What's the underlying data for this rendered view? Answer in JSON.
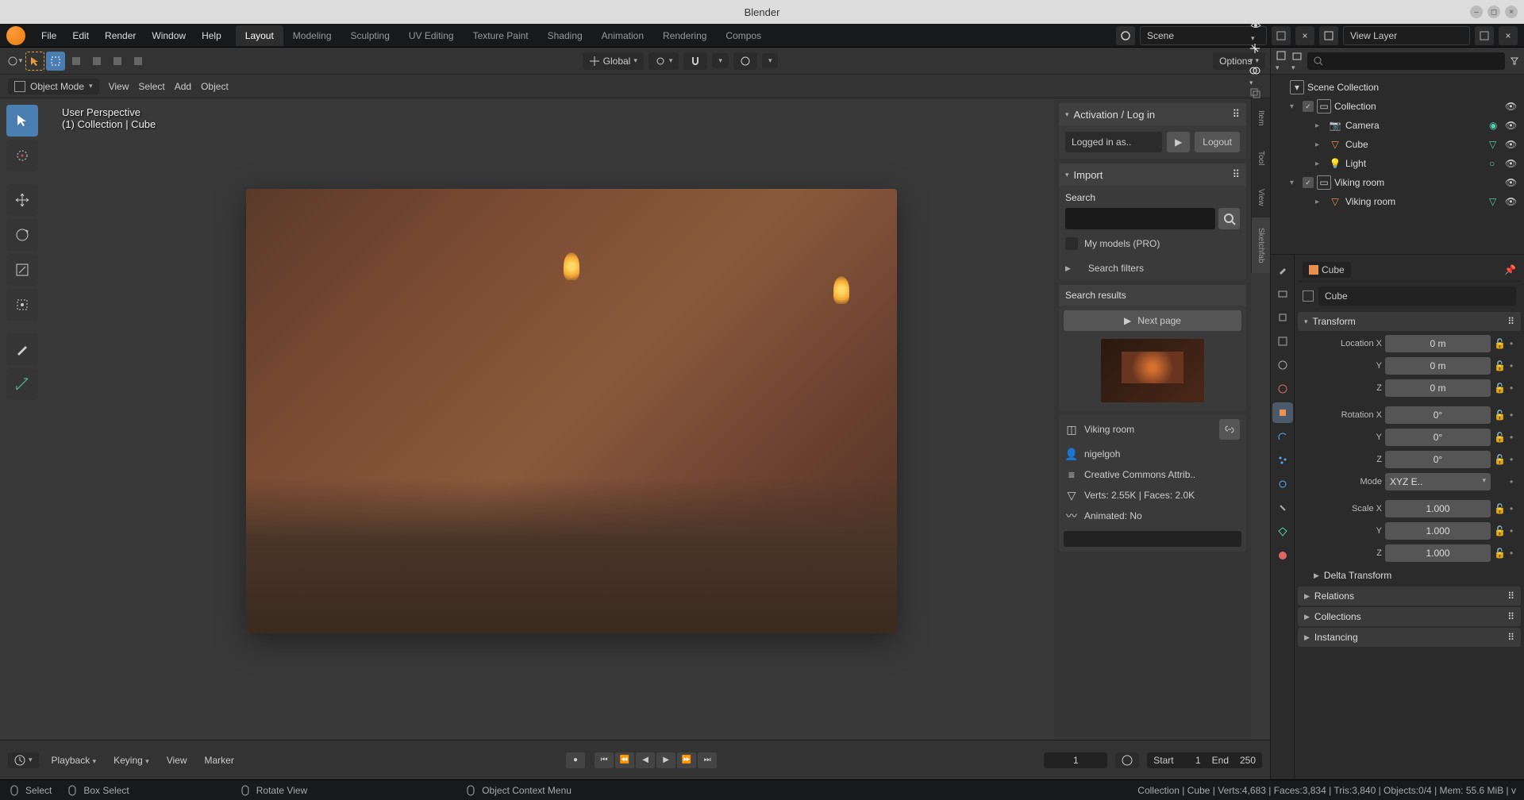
{
  "titlebar": {
    "title": "Blender"
  },
  "menubar": {
    "menus": [
      "File",
      "Edit",
      "Render",
      "Window",
      "Help"
    ],
    "tabs": [
      "Layout",
      "Modeling",
      "Sculpting",
      "UV Editing",
      "Texture Paint",
      "Shading",
      "Animation",
      "Rendering",
      "Compos"
    ],
    "active_tab": 0,
    "scene_label": "Scene",
    "layer_label": "View Layer"
  },
  "vp_header": {
    "orientation": "Global",
    "options": "Options"
  },
  "vp_subheader": {
    "mode": "Object Mode",
    "menus": [
      "View",
      "Select",
      "Add",
      "Object"
    ]
  },
  "overlay": {
    "line1": "User Perspective",
    "line2": "(1) Collection | Cube"
  },
  "side_tabs": [
    "Item",
    "Tool",
    "View",
    "Sketchfab"
  ],
  "sketchfab": {
    "activation_title": "Activation / Log in",
    "logged_in": "Logged in as..",
    "logout": "Logout",
    "import_title": "Import",
    "search_label": "Search",
    "my_models": "My models (PRO)",
    "filters": "Search filters",
    "results_title": "Search results",
    "next_page": "Next page",
    "model_name": "Viking room",
    "author": "nigelgoh",
    "license": "Creative Commons Attrib..",
    "stats": "Verts: 2.55K  |  Faces: 2.0K",
    "animated": "Animated: No"
  },
  "outliner": {
    "root": "Scene Collection",
    "items": [
      {
        "label": "Collection",
        "type": "collection"
      },
      {
        "label": "Camera",
        "type": "camera"
      },
      {
        "label": "Cube",
        "type": "mesh"
      },
      {
        "label": "Light",
        "type": "light"
      },
      {
        "label": "Viking room",
        "type": "collection"
      },
      {
        "label": "Viking room",
        "type": "mesh"
      }
    ]
  },
  "properties": {
    "crumb": "Cube",
    "name": "Cube",
    "transform_title": "Transform",
    "location": {
      "label": "Location X",
      "x": "0 m",
      "y": "0 m",
      "z": "0 m"
    },
    "rotation": {
      "label": "Rotation X",
      "x": "0°",
      "y": "0°",
      "z": "0°"
    },
    "mode": {
      "label": "Mode",
      "value": "XYZ E.."
    },
    "scale": {
      "label": "Scale X",
      "x": "1.000",
      "y": "1.000",
      "z": "1.000"
    },
    "delta": "Delta Transform",
    "sections": [
      "Relations",
      "Collections",
      "Instancing"
    ]
  },
  "timeline": {
    "menus": [
      "Playback",
      "Keying",
      "View",
      "Marker"
    ],
    "current": "1",
    "start_label": "Start",
    "start": "1",
    "end_label": "End",
    "end": "250"
  },
  "statusbar": {
    "select": "Select",
    "box_select": "Box Select",
    "rotate": "Rotate View",
    "context": "Object Context Menu",
    "stats": "Collection | Cube | Verts:4,683 | Faces:3,834 | Tris:3,840 | Objects:0/4 | Mem: 55.6 MiB | v"
  }
}
